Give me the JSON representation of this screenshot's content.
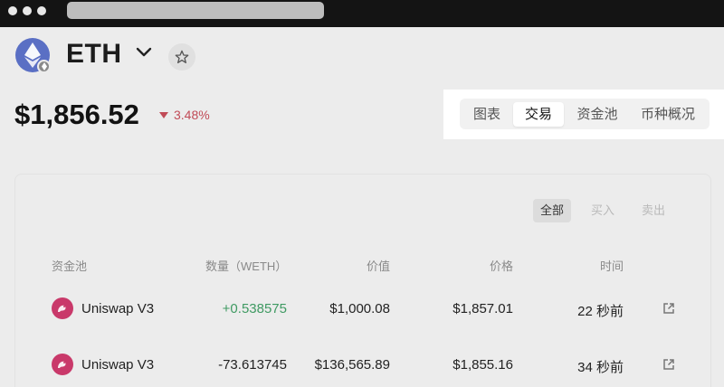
{
  "token": {
    "symbol": "ETH",
    "price": "$1,856.52",
    "change": "3.48%",
    "logo_icon": "ethereum-icon",
    "chain_icon": "ethereum-chain-icon"
  },
  "tabs": [
    {
      "label": "图表",
      "active": false
    },
    {
      "label": "交易",
      "active": true
    },
    {
      "label": "资金池",
      "active": false
    },
    {
      "label": "币种概况",
      "active": false
    }
  ],
  "filters": [
    {
      "label": "全部",
      "active": true
    },
    {
      "label": "买入",
      "active": false
    },
    {
      "label": "卖出",
      "active": false
    }
  ],
  "table": {
    "headers": [
      "资金池",
      "数量（WETH）",
      "价值",
      "价格",
      "时间"
    ],
    "rows": [
      {
        "pool": "Uniswap V3",
        "amount": "+0.538575",
        "value": "$1,000.08",
        "price": "$1,857.01",
        "time": "22 秒前",
        "direction": "buy"
      },
      {
        "pool": "Uniswap V3",
        "amount": "-73.613745",
        "value": "$136,565.89",
        "price": "$1,855.16",
        "time": "34 秒前",
        "direction": "sell"
      }
    ]
  },
  "colors": {
    "positive": "#3f9a62",
    "negative": "#c14b57",
    "eth_logo": "#5a6fc4",
    "uniswap": "#c9396a"
  }
}
